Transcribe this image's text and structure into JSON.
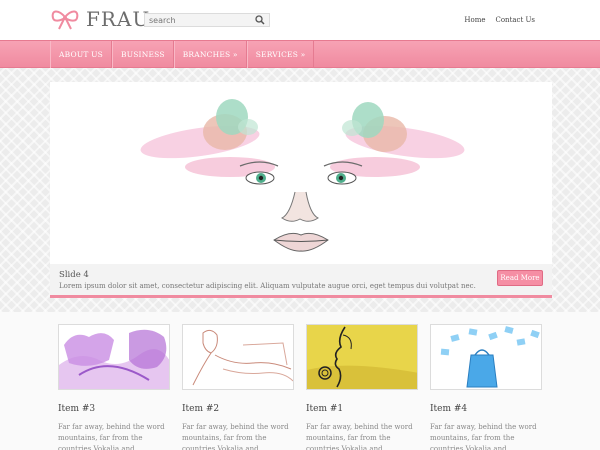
{
  "header": {
    "logo_text": "FRAU",
    "search_placeholder": "search",
    "links": [
      "Home",
      "Contact Us"
    ]
  },
  "nav": {
    "items": [
      "ABOUT US",
      "BUSINESS",
      "BRANCHES »",
      "SERVICES »"
    ]
  },
  "slide": {
    "title": "Slide 4",
    "text": "Lorem ipsum dolor sit amet, consectetur adipiscing elit. Aliquam vulputate augue orci, eget tempus dui volutpat nec.",
    "button": "Read More"
  },
  "items": [
    {
      "title": "Item #3",
      "text": "Far far away, behind the word mountains, far from the countries Vokalia and Consonantia"
    },
    {
      "title": "Item #2",
      "text": "Far far away, behind the word mountains, far from the countries Vokalia and Consonantia"
    },
    {
      "title": "Item #1",
      "text": "Far far away, behind the word mountains, far from the countries Vokalia and Consonantia"
    },
    {
      "title": "Item #4",
      "text": "Far far away, behind the word mountains, far from the countries Vokalia and Consonantia"
    }
  ],
  "colors": {
    "accent": "#f08ba0",
    "button": "#f58ea4"
  }
}
